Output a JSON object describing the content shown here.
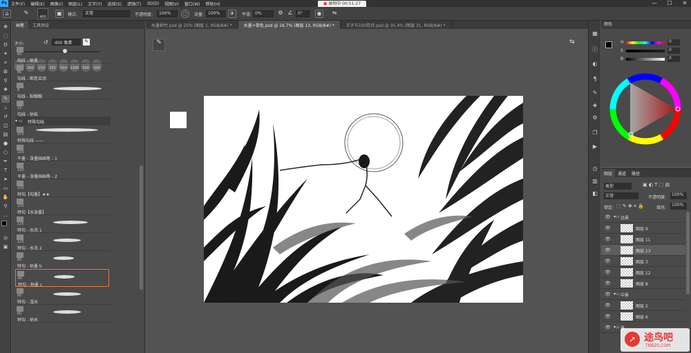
{
  "menubar": {
    "logo": "Ps",
    "items": [
      "文件(F)",
      "编辑(E)",
      "图像(I)",
      "图层(L)",
      "文字(Y)",
      "选择(S)",
      "滤镜(T)",
      "3D(D)",
      "视图(V)",
      "窗口(W)",
      "帮助(H)"
    ],
    "recording": "录制中 00:51:27",
    "rec_dot": "●",
    "win_min": "—",
    "win_max": "☐",
    "win_close": "✕"
  },
  "options": {
    "brush_size": "400",
    "mode_label": "模式:",
    "mode_value": "正常",
    "opacity_label": "不透明度:",
    "opacity_value": "100%",
    "flow_label": "流量:",
    "flow_value": "100%",
    "smoothing_label": "平滑:",
    "smoothing_value": "0%",
    "angle_value": "0°"
  },
  "brush_panel": {
    "tabs": [
      "画笔",
      "工具预设"
    ],
    "size_label": "大小:",
    "size_value": "400 像素",
    "presets": [
      "400",
      "200",
      "150",
      "250",
      "500",
      "1300",
      "500",
      "300"
    ],
    "brushes": [
      {
        "num": "60",
        "name": "勾线 - 枯墨"
      },
      {
        "num": "91",
        "name": "勾线 - 断茬且润"
      },
      {
        "num": "8",
        "name": "勾线 - 黏糊糊"
      },
      {
        "num": "15",
        "name": "勾线 - 枯枝"
      }
    ],
    "group_label": "特殊勾线",
    "brushes2": [
      {
        "num": "973",
        "name": "特殊勾线 ——"
      },
      {
        "num": "100",
        "name": "干墨 - 泼墨国画笔 - 1"
      },
      {
        "num": "100",
        "name": "干墨 - 泼墨国画笔 - 2"
      },
      {
        "num": "102",
        "name": "特勾【勾墨】★★"
      },
      {
        "num": "100",
        "name": "特勾【水泼墨】"
      },
      {
        "num": "125",
        "name": "特勾 - 水洗 1"
      },
      {
        "num": "125",
        "name": "特勾 - 水洗 2"
      },
      {
        "num": "60",
        "name": "特勾 - 枯墨 b"
      },
      {
        "num": "60",
        "name": "特勾 - 枯墨 c"
      },
      {
        "num": "60",
        "name": "特勾 - 湿水"
      },
      {
        "num": "60",
        "name": "特勾 - 枯水"
      }
    ]
  },
  "doc_tabs": [
    "水墨树竹.psd @ 25% (图层 1, RGB/8#) *",
    "水墨+单色.psd @ 16.7% (图层 13, RGB/8#) *",
    "王子与100符合.psd @ 35.4% (图层 31, RGB/8#) *"
  ],
  "color_panel": {
    "tab": "颜色",
    "h_label": "H",
    "h_value": "0",
    "s_label": "S",
    "s_value": "0",
    "b_label": "B",
    "b_value": "0"
  },
  "layers_panel": {
    "tabs": [
      "图层",
      "通道",
      "路径"
    ],
    "kind_label": "类型",
    "blend_mode": "正常",
    "opacity_label": "不透明度:",
    "opacity_value": "100%",
    "lock_label": "锁定:",
    "fill_label": "填充:",
    "fill_value": "100%",
    "group1": "远景",
    "layers1": [
      "图层 9",
      "图层 11",
      "图层 13",
      "图层 3",
      "图层 12",
      "图层 8"
    ],
    "group2": "中景",
    "layers2": [
      "图层 2",
      "图层 6"
    ],
    "group3": "景"
  },
  "watermark": {
    "title": "途鸟吧",
    "url": "TNBZS.COM"
  },
  "colors": {
    "accent": "#31a8ff",
    "selection": "#e07a3a"
  }
}
